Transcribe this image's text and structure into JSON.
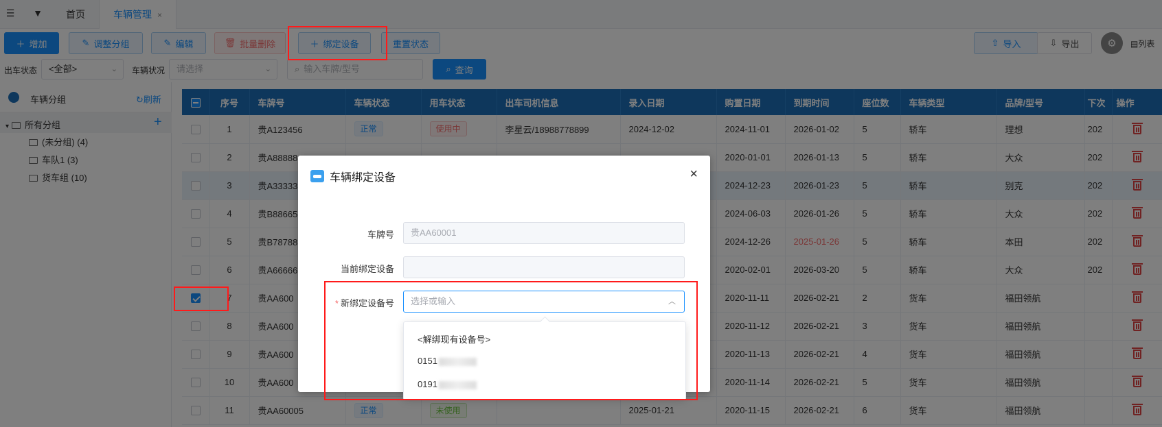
{
  "tabs": [
    {
      "label": "首页"
    },
    {
      "label": "车辆管理",
      "close": "×"
    }
  ],
  "toolbar": {
    "add": "增加",
    "regroup": "调整分组",
    "edit": "编辑",
    "batch_delete": "批量删除",
    "bind_device": "绑定设备",
    "reset_status": "重置状态",
    "import": "导入",
    "export": "导出",
    "columns": "列表"
  },
  "filters": {
    "dispatch_label": "出车状态",
    "dispatch_value": "<全部>",
    "condition_label": "车辆状况",
    "condition_placeholder": "请选择",
    "search_placeholder": "输入车牌/型号",
    "query": "查询"
  },
  "sidebar": {
    "title": "车辆分组",
    "refresh": "刷新",
    "groups": [
      {
        "label": "所有分组"
      },
      {
        "label": "(未分组) (4)"
      },
      {
        "label": "车队1 (3)"
      },
      {
        "label": "货车组 (10)"
      }
    ]
  },
  "table": {
    "headers": [
      "序号",
      "车牌号",
      "车辆状态",
      "用车状态",
      "出车司机信息",
      "录入日期",
      "购置日期",
      "到期时间",
      "座位数",
      "车辆类型",
      "品牌/型号",
      "下次",
      "操作"
    ],
    "rows": [
      {
        "no": "1",
        "plate": "贵A123456",
        "status": "正常",
        "use": "使用中",
        "driver": "李星云/18988778899",
        "entry": "2024-12-02",
        "buy": "2024-11-01",
        "expire": "2026-01-02",
        "seats": "5",
        "type": "轿车",
        "brand": "理想",
        "next": "202"
      },
      {
        "no": "2",
        "plate": "贵A88888",
        "status": "",
        "use": "",
        "driver": "",
        "entry": "",
        "buy": "2020-01-01",
        "expire": "2026-01-13",
        "seats": "5",
        "type": "轿车",
        "brand": "大众",
        "next": "202"
      },
      {
        "no": "3",
        "plate": "贵A33333",
        "status": "",
        "use": "",
        "driver": "",
        "entry": "",
        "buy": "2024-12-23",
        "expire": "2026-01-23",
        "seats": "5",
        "type": "轿车",
        "brand": "别克",
        "next": "202"
      },
      {
        "no": "4",
        "plate": "贵B88665",
        "status": "",
        "use": "",
        "driver": "",
        "entry": "",
        "buy": "2024-06-03",
        "expire": "2026-01-26",
        "seats": "5",
        "type": "轿车",
        "brand": "大众",
        "next": "202"
      },
      {
        "no": "5",
        "plate": "贵B78788",
        "status": "",
        "use": "",
        "driver": "",
        "entry": "",
        "buy": "2024-12-26",
        "expire": "2025-01-26",
        "seats": "5",
        "type": "轿车",
        "brand": "本田",
        "next": "202"
      },
      {
        "no": "6",
        "plate": "贵A66666",
        "status": "",
        "use": "",
        "driver": "",
        "entry": "",
        "buy": "2020-02-01",
        "expire": "2026-03-20",
        "seats": "5",
        "type": "轿车",
        "brand": "大众",
        "next": "202"
      },
      {
        "no": "7",
        "plate": "贵AA600",
        "status": "",
        "use": "",
        "driver": "",
        "entry": "",
        "buy": "2020-11-11",
        "expire": "2026-02-21",
        "seats": "2",
        "type": "货车",
        "brand": "福田领航",
        "next": ""
      },
      {
        "no": "8",
        "plate": "贵AA600",
        "status": "",
        "use": "",
        "driver": "",
        "entry": "",
        "buy": "2020-11-12",
        "expire": "2026-02-21",
        "seats": "3",
        "type": "货车",
        "brand": "福田领航",
        "next": ""
      },
      {
        "no": "9",
        "plate": "贵AA600",
        "status": "",
        "use": "",
        "driver": "",
        "entry": "",
        "buy": "2020-11-13",
        "expire": "2026-02-21",
        "seats": "4",
        "type": "货车",
        "brand": "福田领航",
        "next": ""
      },
      {
        "no": "10",
        "plate": "贵AA600",
        "status": "",
        "use": "",
        "driver": "",
        "entry": "",
        "buy": "2020-11-14",
        "expire": "2026-02-21",
        "seats": "5",
        "type": "货车",
        "brand": "福田领航",
        "next": ""
      },
      {
        "no": "11",
        "plate": "贵AA60005",
        "status": "正常",
        "use": "未使用",
        "driver": "",
        "entry": "2025-01-21",
        "buy": "2020-11-15",
        "expire": "2026-02-21",
        "seats": "6",
        "type": "货车",
        "brand": "福田领航",
        "next": ""
      }
    ]
  },
  "dialog": {
    "title": "车辆绑定设备",
    "close": "×",
    "plate_label": "车牌号",
    "plate_value": "贵AA60001",
    "current_label": "当前绑定设备",
    "current_value": "",
    "required_mark": "*",
    "new_label": "新绑定设备号",
    "new_placeholder": "选择或输入",
    "options": [
      {
        "label": "<解绑现有设备号>"
      },
      {
        "label": "0151"
      },
      {
        "label": "0191"
      }
    ]
  },
  "colors": {
    "primary": "#1890ff",
    "header": "#1d6fb8",
    "danger": "#f56c6c",
    "highlight": "#ff1a1a"
  }
}
